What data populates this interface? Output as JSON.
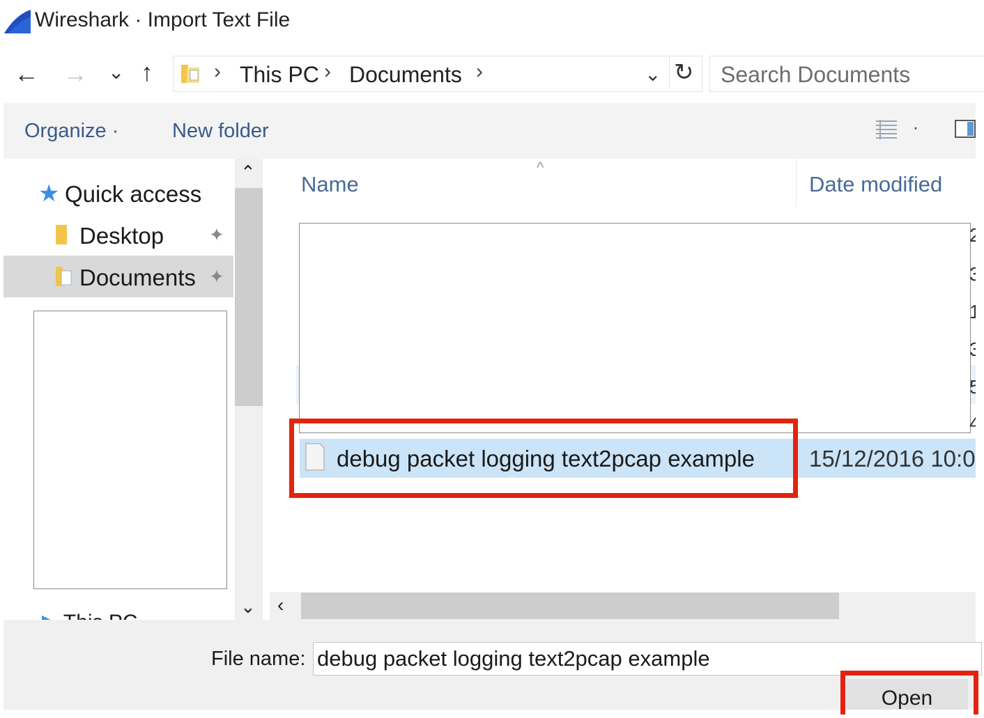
{
  "window": {
    "title": "Wireshark · Import Text File",
    "icon": "wireshark-fin-icon"
  },
  "navigation": {
    "back_icon": "←",
    "forward_icon": "→",
    "recent_icon": "⌄",
    "up_icon": "↑",
    "breadcrumbs": [
      "This PC",
      "Documents"
    ],
    "separator": "›",
    "refresh_icon": "↻",
    "search_placeholder": "Search Documents"
  },
  "command_bar": {
    "organize_label": "Organize ·",
    "new_folder_label": "New folder"
  },
  "nav_pane": {
    "quick_access": "Quick access",
    "items": [
      {
        "label": "Desktop",
        "pinned": true
      },
      {
        "label": "Documents",
        "pinned": true,
        "selected": true
      }
    ],
    "this_pc_partial": "This PC",
    "pin_icon": "✦"
  },
  "file_list": {
    "columns": [
      "Name",
      "Date modified"
    ],
    "sort_caret": "^",
    "right_edge_glyphs": [
      "2",
      "3",
      "1",
      "3",
      "5",
      "4"
    ],
    "selected_file": {
      "name": "debug packet logging text2pcap example",
      "date_modified": "15/12/2016 10:0"
    }
  },
  "footer": {
    "file_name_label": "File name:",
    "file_name_value": "debug packet logging text2pcap example",
    "open_label": "Open"
  },
  "colors": {
    "highlight_annotation": "#e3230f",
    "selection": "#cce4f7",
    "link_text": "#3a5a8c"
  }
}
